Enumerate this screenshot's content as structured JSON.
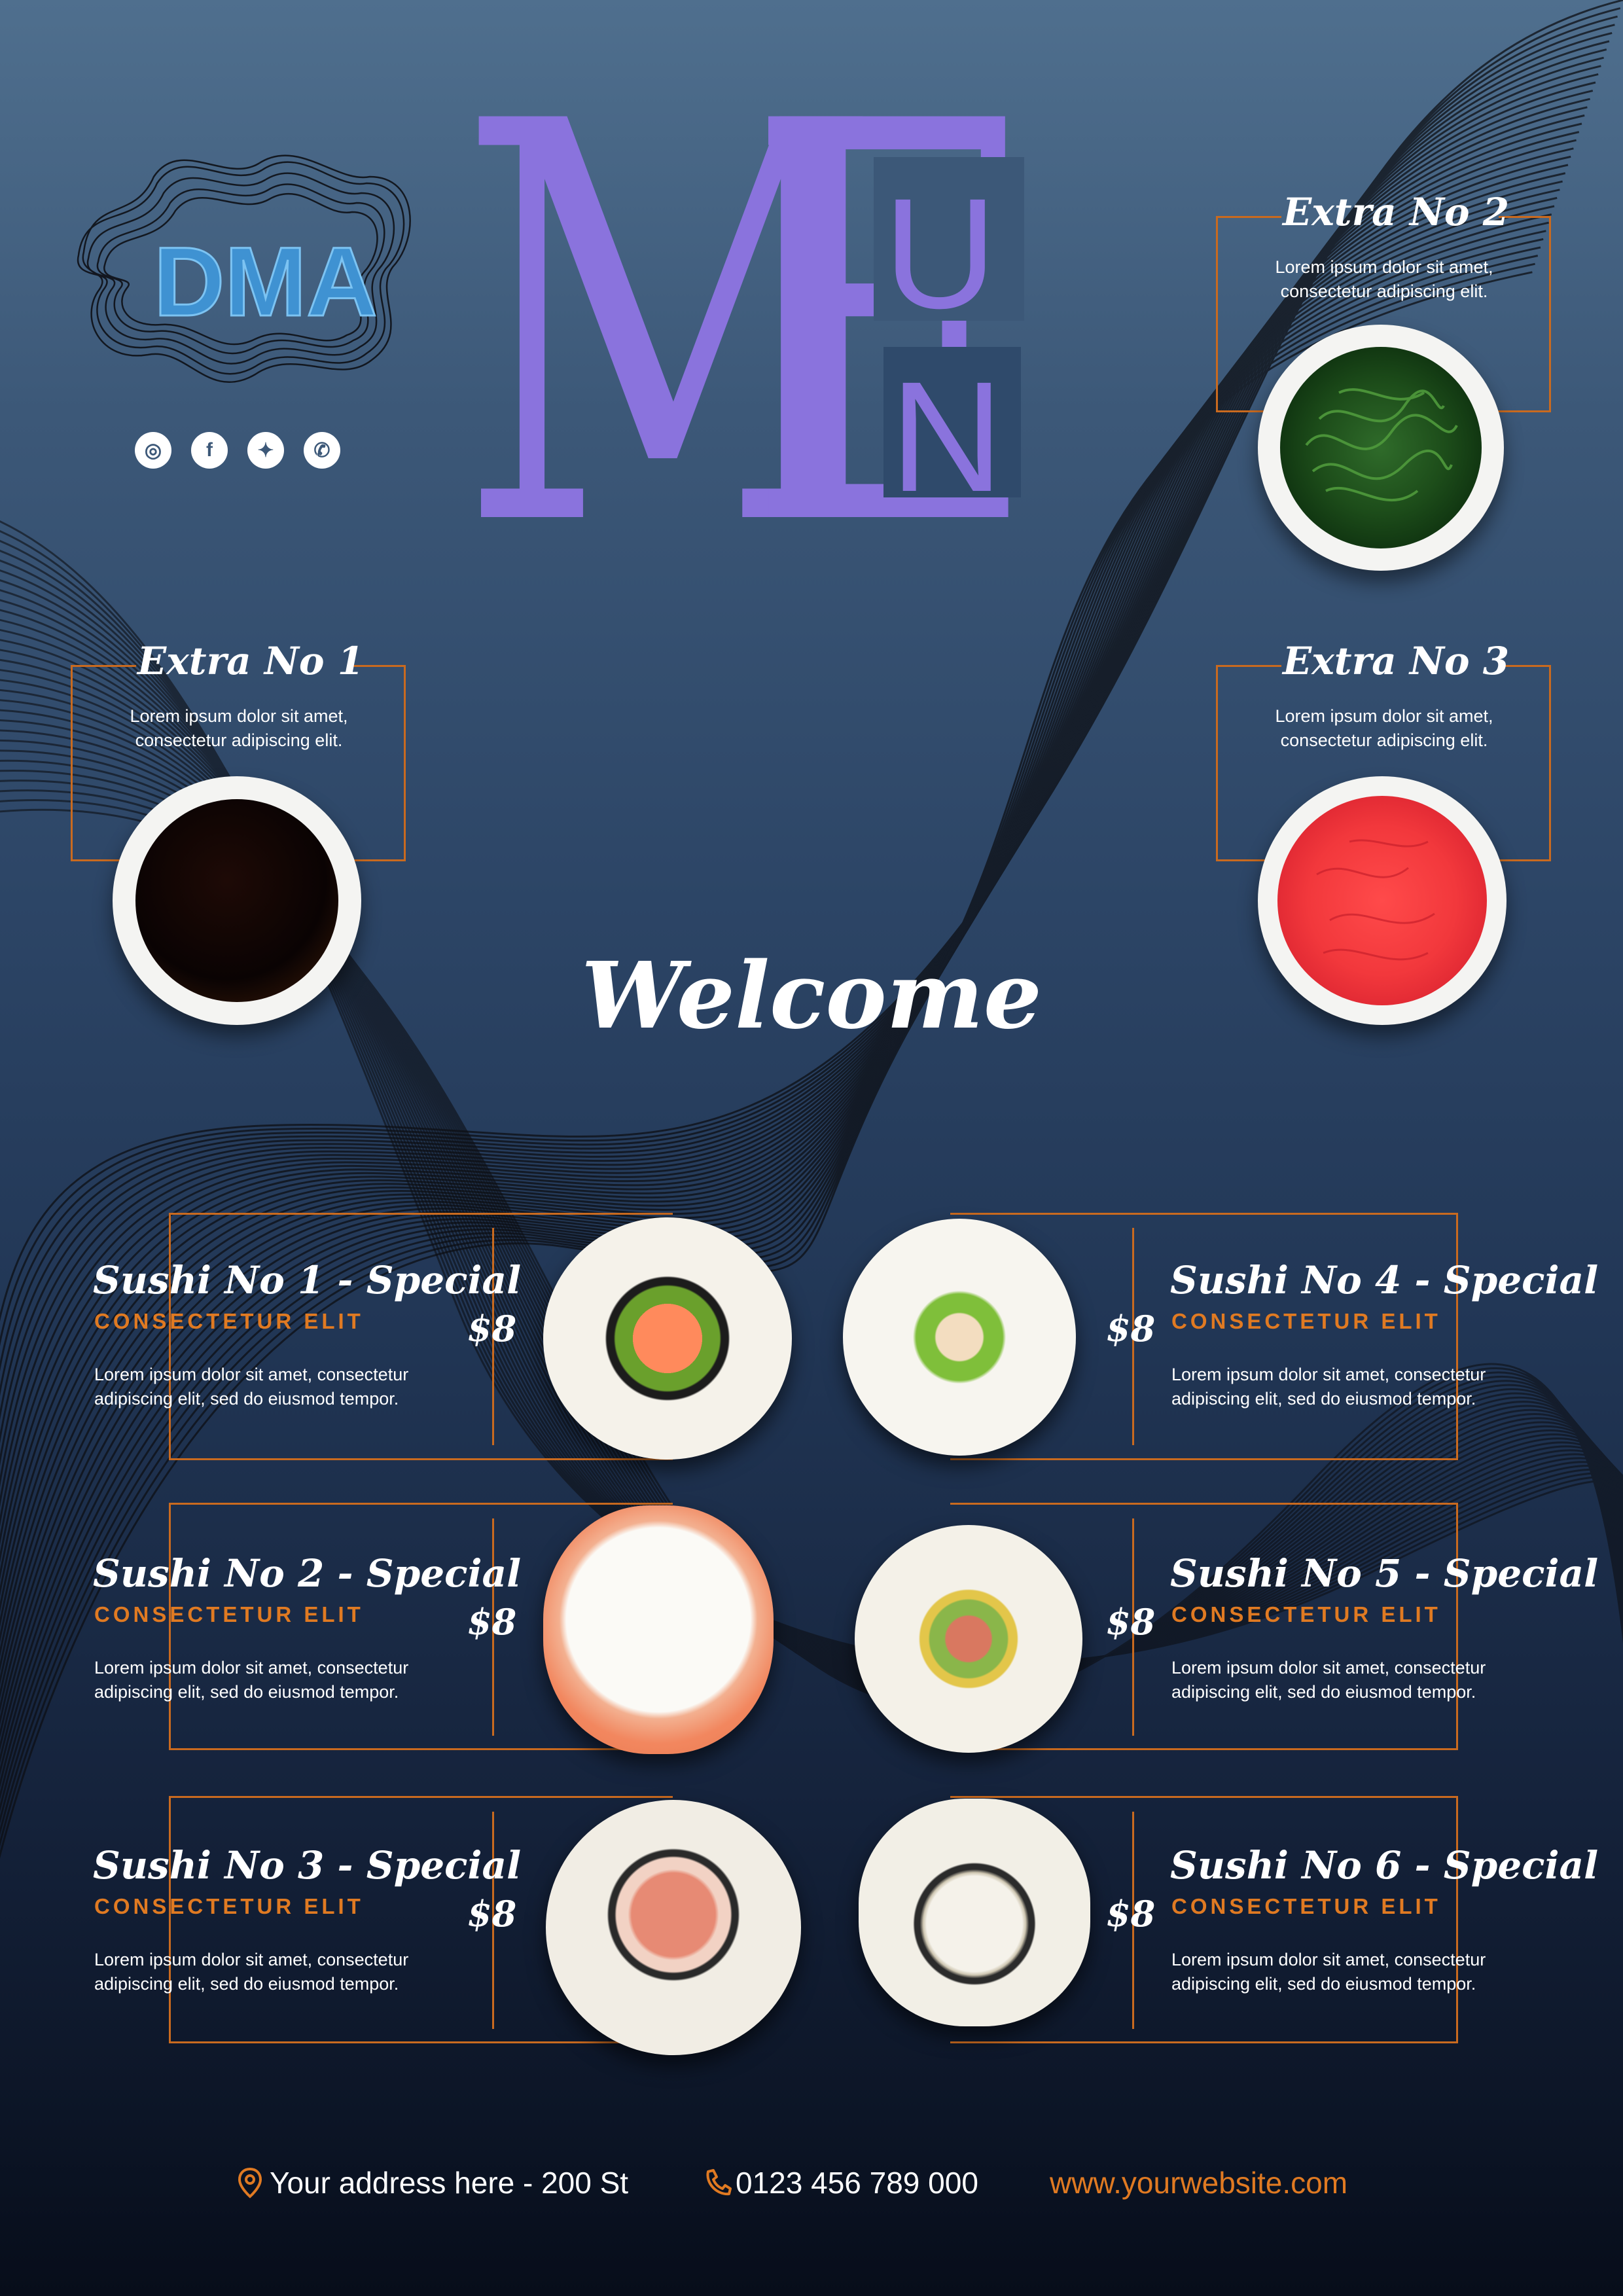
{
  "brand": {
    "logo_text": "DMA"
  },
  "title_letters": {
    "big": "M",
    "e": "E",
    "u": "U",
    "n": "N"
  },
  "socials": [
    {
      "icon": "instagram-icon",
      "glyph": "◎"
    },
    {
      "icon": "facebook-icon",
      "glyph": "f"
    },
    {
      "icon": "twitter-icon",
      "glyph": "✦"
    },
    {
      "icon": "whatsapp-icon",
      "glyph": "✆"
    }
  ],
  "extras": [
    {
      "title": "Extra No 1",
      "desc_line1": "Lorem ipsum dolor sit amet,",
      "desc_line2": "consectetur adipiscing elit."
    },
    {
      "title": "Extra No 2",
      "desc_line1": "Lorem ipsum dolor sit amet,",
      "desc_line2": "consectetur adipiscing elit."
    },
    {
      "title": "Extra No 3",
      "desc_line1": "Lorem ipsum dolor sit amet,",
      "desc_line2": "consectetur adipiscing elit."
    }
  ],
  "welcome": "Welcome",
  "sushi": [
    {
      "title": "Sushi No 1 - Special",
      "subtitle": "CONSECTETUR ELIT",
      "price": "$8",
      "desc_line1": "Lorem ipsum dolor sit amet, consectetur",
      "desc_line2": "adipiscing elit, sed do eiusmod tempor."
    },
    {
      "title": "Sushi No 2 - Special",
      "subtitle": "CONSECTETUR ELIT",
      "price": "$8",
      "desc_line1": "Lorem ipsum dolor sit amet, consectetur",
      "desc_line2": "adipiscing elit, sed do eiusmod tempor."
    },
    {
      "title": "Sushi No 3 - Special",
      "subtitle": "CONSECTETUR ELIT",
      "price": "$8",
      "desc_line1": "Lorem ipsum dolor sit amet, consectetur",
      "desc_line2": "adipiscing elit, sed do eiusmod tempor."
    },
    {
      "title": "Sushi No 4 - Special",
      "subtitle": "CONSECTETUR ELIT",
      "price": "$8",
      "desc_line1": "Lorem ipsum dolor sit amet, consectetur",
      "desc_line2": "adipiscing elit, sed do eiusmod tempor."
    },
    {
      "title": "Sushi No 5 - Special",
      "subtitle": "CONSECTETUR ELIT",
      "price": "$8",
      "desc_line1": "Lorem ipsum dolor sit amet, consectetur",
      "desc_line2": "adipiscing elit, sed do eiusmod tempor."
    },
    {
      "title": "Sushi No 6 - Special",
      "subtitle": "CONSECTETUR ELIT",
      "price": "$8",
      "desc_line1": "Lorem ipsum dolor sit amet, consectetur",
      "desc_line2": "adipiscing elit, sed do eiusmod tempor."
    }
  ],
  "footer": {
    "address": "Your address here - 200 St",
    "phone": "0123 456 789 000",
    "website": "www.yourwebsite.com"
  },
  "colors": {
    "accent_orange": "#e07a22",
    "frame_orange": "#c96a1f",
    "title_purple": "#8a73dd",
    "logo_blue": "#3f92d2"
  }
}
